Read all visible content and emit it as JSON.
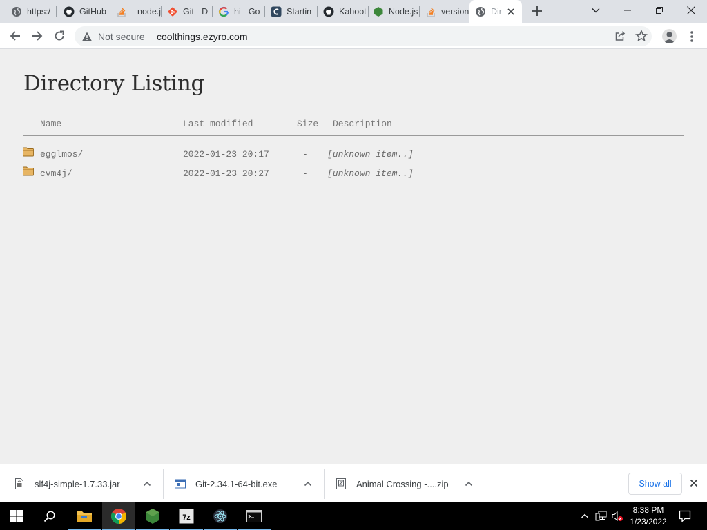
{
  "browser": {
    "tabs": [
      {
        "title": "https:/",
        "favicon": "globe-icon"
      },
      {
        "title": "GitHub",
        "favicon": "github-icon"
      },
      {
        "title": "node.js",
        "favicon": "stackoverflow-icon"
      },
      {
        "title": "Git - D",
        "favicon": "git-icon"
      },
      {
        "title": "hi - Go",
        "favicon": "google-icon"
      },
      {
        "title": "Startin",
        "favicon": "c-logo-icon"
      },
      {
        "title": "Kahoot",
        "favicon": "github-icon"
      },
      {
        "title": "Node.js",
        "favicon": "nodejs-icon"
      },
      {
        "title": "version",
        "favicon": "stackoverflow-icon"
      },
      {
        "title": "Dir",
        "favicon": "globe-icon",
        "active": true
      }
    ],
    "security_label": "Not secure",
    "url": "coolthings.ezyro.com"
  },
  "page": {
    "title": "Directory Listing",
    "columns": {
      "name": "Name",
      "modified": "Last modified",
      "size": "Size",
      "description": "Description"
    },
    "rows": [
      {
        "name": "egglmos/",
        "modified": "2022-01-23 20:17",
        "size": "-",
        "description": "[unknown item..]"
      },
      {
        "name": "cvm4j/",
        "modified": "2022-01-23 20:27",
        "size": "-",
        "description": "[unknown item..]"
      }
    ]
  },
  "downloads": {
    "items": [
      {
        "name": "slf4j-simple-1.7.33.jar",
        "icon": "jar-file-icon"
      },
      {
        "name": "Git-2.34.1-64-bit.exe",
        "icon": "exe-file-icon"
      },
      {
        "name": "Animal Crossing -....zip",
        "icon": "zip-file-icon"
      }
    ],
    "show_all_label": "Show all"
  },
  "taskbar": {
    "apps": [
      "start-icon",
      "search-icon",
      "file-explorer-icon",
      "chrome-icon",
      "nodejs-icon",
      "7zip-icon",
      "electron-icon",
      "terminal-icon"
    ],
    "time": "8:38 PM",
    "date": "1/23/2022"
  },
  "colors": {
    "tabstrip": "#dee1e6",
    "page_background": "#efefef",
    "link_blue": "#1a73e8",
    "taskbar": "#000000"
  }
}
